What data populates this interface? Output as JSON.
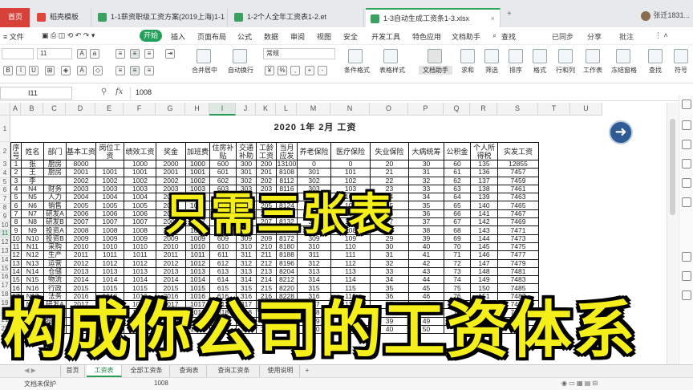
{
  "tabs": {
    "home": "首页",
    "t1": "稻壳模板",
    "t2": "1-1薪资职级工资方案(2019上海)1-1",
    "t3": "1-2个人全年工资表1-2.et",
    "t4": "1-3自动生成工资条1-3.xlsx",
    "add": "+",
    "user": "张迁1831...",
    "colors": {
      "wps_red": "#d8413a",
      "xls_green": "#2fa85a"
    }
  },
  "menu": {
    "file": "≡ 文件",
    "items": [
      "开始",
      "插入",
      "页面布局",
      "公式",
      "数据",
      "审阅",
      "视图",
      "安全",
      "开发工具",
      "特色应用",
      "文档助手"
    ],
    "search": "查找",
    "sync": "已同步",
    "share": "分享",
    "comment": "批注"
  },
  "ribbon": {
    "font_size": "11",
    "merge": "合并居中",
    "wrap": "自动换行",
    "format": "常规",
    "buttons": [
      "条件格式",
      "表格样式",
      "文档助手",
      "求和",
      "筛选",
      "排序",
      "格式",
      "行和列",
      "工作表",
      "冻结窗格",
      "查找",
      "符号"
    ]
  },
  "formula_bar": {
    "cell_ref": "I11",
    "fx": "fx",
    "value": "1008"
  },
  "columns": [
    "A",
    "B",
    "C",
    "D",
    "E",
    "F",
    "G",
    "H",
    "I",
    "J",
    "K",
    "L",
    "M",
    "N",
    "O",
    "P",
    "Q",
    "R",
    "S",
    "T",
    "U"
  ],
  "row_numbers": [
    "1",
    "2",
    "3",
    "4",
    "5",
    "6",
    "7",
    "8",
    "9",
    "10",
    "11",
    "12",
    "13",
    "14",
    "15",
    "16",
    "17",
    "18",
    "19",
    "20",
    "21",
    "22"
  ],
  "sheet": {
    "title": "2020  1年  2月  工资",
    "headers": [
      "序号",
      "姓名",
      "部门",
      "基本工资",
      "岗位工资",
      "绩效工资",
      "奖金",
      "加班费",
      "住房补贴",
      "交通补助",
      "工龄工资",
      "当月应发",
      "养老保险",
      "医疗保险",
      "失业保险",
      "大病统筹",
      "公积金",
      "个人所得税",
      "实发工资"
    ],
    "rows": [
      [
        "1",
        "张",
        "厨房",
        "8000",
        "",
        "1000",
        "2000",
        "1000",
        "600",
        "300",
        "200",
        "13100",
        "0",
        "0",
        "20",
        "30",
        "60",
        "135",
        "12855"
      ],
      [
        "2",
        "王",
        "厨房",
        "2001",
        "1001",
        "1001",
        "2001",
        "1001",
        "601",
        "301",
        "201",
        "8108",
        "301",
        "101",
        "21",
        "31",
        "61",
        "136",
        "7457"
      ],
      [
        "3",
        "李",
        "",
        "2002",
        "1002",
        "1002",
        "2002",
        "1002",
        "602",
        "302",
        "202",
        "8112",
        "302",
        "102",
        "22",
        "32",
        "62",
        "137",
        "7459"
      ],
      [
        "4",
        "N4",
        "财务",
        "2003",
        "1003",
        "1003",
        "2003",
        "1003",
        "603",
        "303",
        "203",
        "8116",
        "303",
        "103",
        "23",
        "33",
        "63",
        "138",
        "7461"
      ],
      [
        "5",
        "N5",
        "人力",
        "2004",
        "1004",
        "1004",
        "2004",
        "1004",
        "604",
        "304",
        "204",
        "8120",
        "304",
        "104",
        "24",
        "34",
        "64",
        "139",
        "7463"
      ],
      [
        "6",
        "N6",
        "销售",
        "2005",
        "1005",
        "1005",
        "2005",
        "1005",
        "605",
        "305",
        "205",
        "8124",
        "305",
        "105",
        "25",
        "35",
        "65",
        "140",
        "7465"
      ],
      [
        "7",
        "N7",
        "研发A",
        "2006",
        "1006",
        "1006",
        "2006",
        "1006",
        "606",
        "306",
        "206",
        "8128",
        "306",
        "106",
        "26",
        "36",
        "66",
        "141",
        "7467"
      ],
      [
        "8",
        "N8",
        "研发B",
        "2007",
        "1007",
        "1007",
        "2007",
        "1007",
        "607",
        "307",
        "207",
        "8132",
        "307",
        "107",
        "27",
        "37",
        "67",
        "142",
        "7469"
      ],
      [
        "9",
        "N9",
        "投资A",
        "2008",
        "1008",
        "1008",
        "2008",
        "1008",
        "608",
        "308",
        "208",
        "8136",
        "308",
        "108",
        "28",
        "38",
        "68",
        "143",
        "7471"
      ],
      [
        "10",
        "N10",
        "投资B",
        "2009",
        "1009",
        "1009",
        "2009",
        "1009",
        "609",
        "309",
        "209",
        "8172",
        "309",
        "109",
        "29",
        "39",
        "69",
        "144",
        "7473"
      ],
      [
        "11",
        "N11",
        "采购",
        "2010",
        "1010",
        "1010",
        "2010",
        "1010",
        "610",
        "310",
        "210",
        "8180",
        "310",
        "110",
        "30",
        "40",
        "70",
        "145",
        "7475"
      ],
      [
        "12",
        "N12",
        "生产",
        "2011",
        "1011",
        "1011",
        "2011",
        "1011",
        "611",
        "311",
        "211",
        "8188",
        "311",
        "111",
        "31",
        "41",
        "71",
        "146",
        "7477"
      ],
      [
        "13",
        "N13",
        "运营",
        "2012",
        "1012",
        "1012",
        "2012",
        "1012",
        "612",
        "312",
        "212",
        "8196",
        "312",
        "112",
        "32",
        "42",
        "72",
        "147",
        "7479"
      ],
      [
        "14",
        "N14",
        "仓储",
        "2013",
        "1013",
        "1013",
        "2013",
        "1013",
        "613",
        "313",
        "213",
        "8204",
        "313",
        "113",
        "33",
        "43",
        "73",
        "148",
        "7481"
      ],
      [
        "15",
        "N15",
        "物流",
        "2014",
        "1014",
        "1014",
        "2014",
        "1014",
        "614",
        "314",
        "214",
        "8212",
        "314",
        "114",
        "34",
        "44",
        "74",
        "149",
        "7483"
      ],
      [
        "16",
        "N16",
        "行政",
        "2015",
        "1015",
        "1015",
        "2015",
        "1015",
        "615",
        "315",
        "215",
        "8220",
        "315",
        "115",
        "35",
        "45",
        "75",
        "150",
        "7485"
      ],
      [
        "17",
        "N17",
        "法务",
        "2016",
        "1016",
        "1016",
        "2016",
        "1016",
        "616",
        "316",
        "216",
        "8228",
        "316",
        "116",
        "36",
        "46",
        "76",
        "151",
        "7487"
      ],
      [
        "18",
        "N18",
        "研发A",
        "2017",
        "1017",
        "1017",
        "2017",
        "1017",
        "617",
        "317",
        "217",
        "8236",
        "317",
        "117",
        "37",
        "47",
        "77",
        "152",
        "7489"
      ],
      [
        "19",
        "N19",
        "投资A",
        "2018",
        "1018",
        "1018",
        "2018",
        "1018",
        "618",
        "318",
        "218",
        "8244",
        "318",
        "118",
        "38",
        "48",
        "78",
        "153",
        "7491"
      ],
      [
        "20",
        "N20",
        "投资B",
        "2019",
        "1019",
        "1019",
        "2019",
        "1019",
        "619",
        "319",
        "219",
        "8252",
        "319",
        "119",
        "39",
        "49",
        "79",
        "154",
        "7493"
      ],
      [
        "21",
        "N21",
        "采购",
        "2020",
        "1020",
        "1020",
        "2020",
        "1020",
        "620",
        "320",
        "220",
        "8260",
        "320",
        "120",
        "40",
        "50",
        "80",
        "155",
        "7495"
      ]
    ]
  },
  "sheet_tabs": [
    "首页",
    "工资表",
    "全部工资条",
    "查询表",
    "查询工资条",
    "使用说明"
  ],
  "active_sheet_tab": "工资表",
  "status": {
    "protect": "文档未保护",
    "value": "1008"
  },
  "captions": {
    "line1": "只需三张表",
    "line2": "构成你公司的工资体系"
  },
  "colors": {
    "caption_yellow": "#f4ee1a",
    "accent_green": "#23a05a",
    "arrow_blue": "#2e5b94"
  }
}
